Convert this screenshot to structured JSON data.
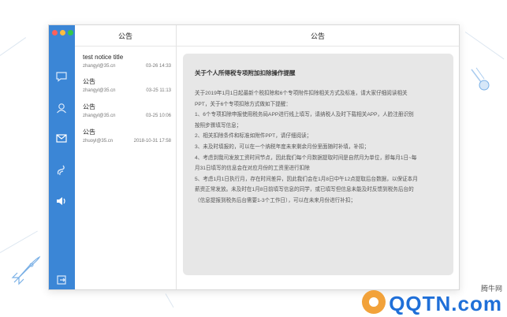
{
  "window": {
    "list_title": "公告",
    "detail_title": "公告"
  },
  "sidebar": {
    "icons": [
      "chat-bubble-icon",
      "user-icon",
      "mail-icon",
      "send-icon",
      "speaker-icon",
      "logout-icon"
    ]
  },
  "notices": [
    {
      "title": "test notice title",
      "sender": "zhangyl@35.cn",
      "time": "03-26 14:33"
    },
    {
      "title": "公告",
      "sender": "zhangyl@35.cn",
      "time": "03-25 11:13"
    },
    {
      "title": "公告",
      "sender": "zhangyl@35.cn",
      "time": "03-25 10:06"
    },
    {
      "title": "公告",
      "sender": "zhuoyl@35.cn",
      "time": "2018-10-31 17:58"
    }
  ],
  "detail": {
    "heading": "关于个人所得税专项附加扣除操作提醒",
    "lines": [
      "关于2019年1月1日起最新个税扣除和6个专项附件扣除相关方式及标准，请大家仔细阅读相关",
      "PPT，关于6个专项扣除方式做如下提醒：",
      "1、6个专项扣除申报使用税务局APP进行线上填写，请纳税人及时下载相关APP，人脸注册识别",
      "按照步骤填写信息；",
      "2、相关扣除条件和标准如附件PPT，请仔细阅读；",
      "3、未及时填报的，可以在一个纳税年度未来剩余月份里面随时补填，补扣；",
      "4、考虑到我司发放工资时间节点，因此我们每个月数据提取时间是自然月为单位，即每月1日~每",
      "月31日填写的信息会在对应月份的工资里进行扣除",
      "5、考虑1月1日执行月，存在时间差异，因此我们会在1月8日中午12点提取后台数据，以保证本月",
      "薪资正常发放。未及时在1月8日前填写信息的同学，或已填写但信息未能及时反馈到税务后台的",
      "（信息提报到税务后台需要1-3个工作日），可以在未来月份进行补扣；"
    ]
  },
  "watermark": {
    "small": "腾牛网",
    "big": "QQTN.com"
  }
}
